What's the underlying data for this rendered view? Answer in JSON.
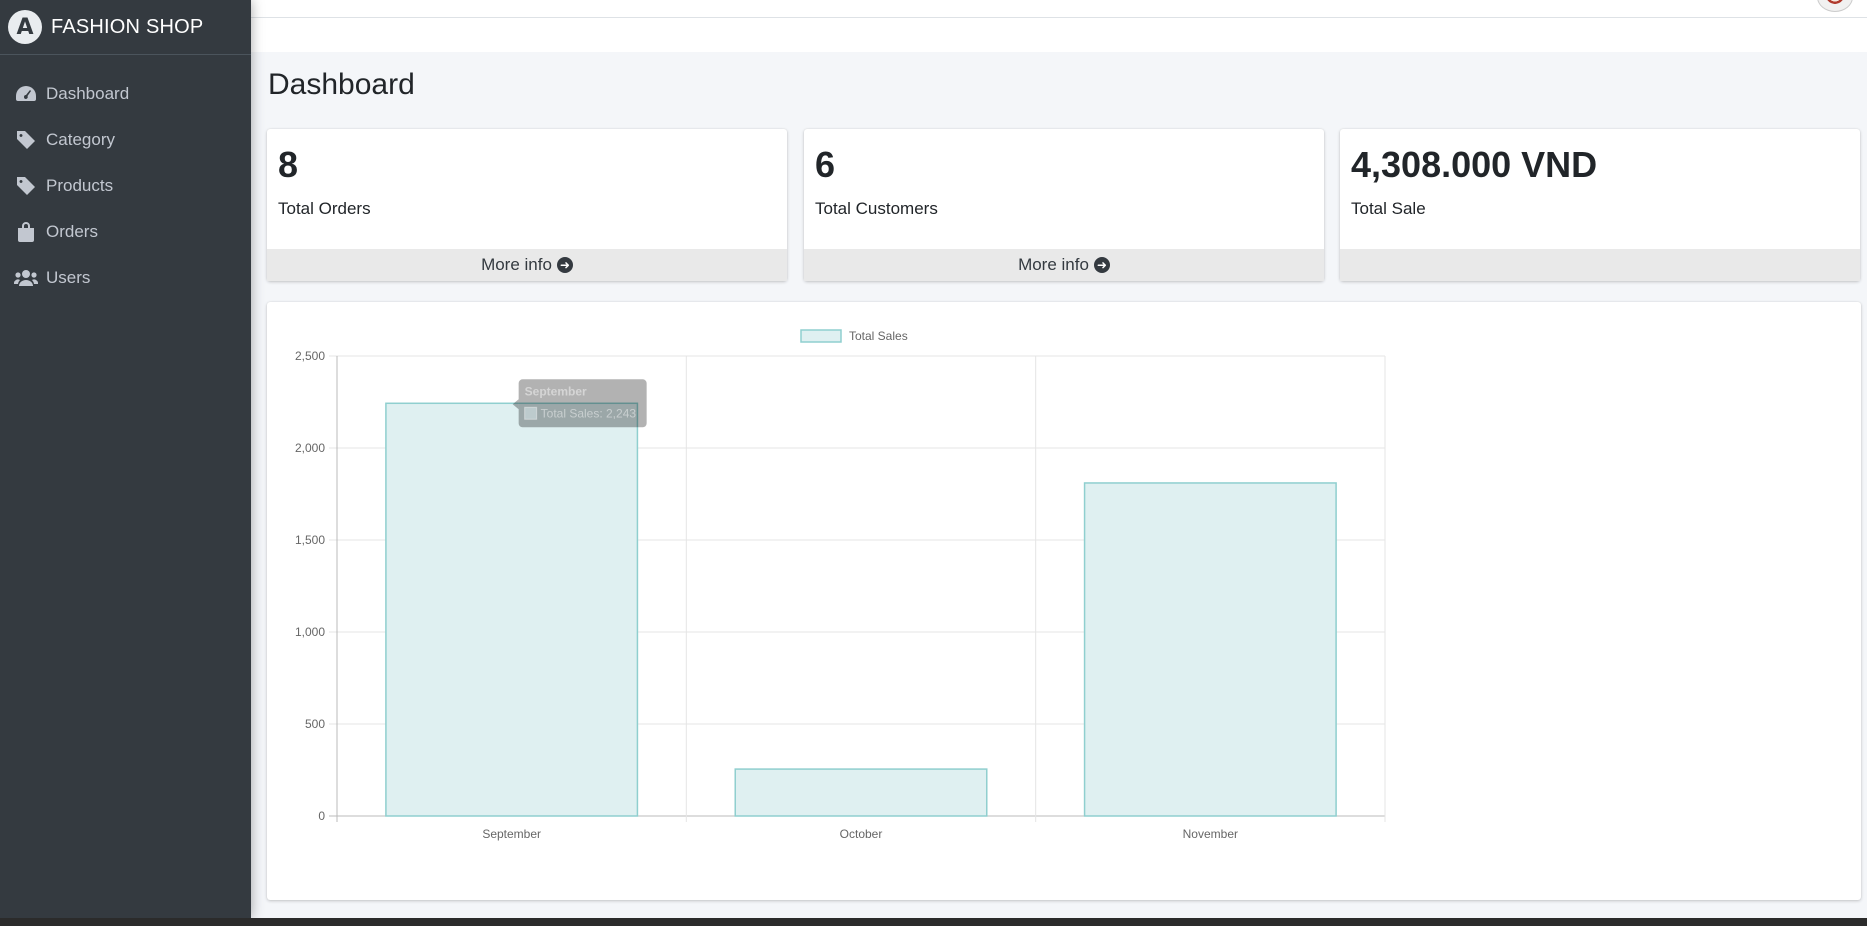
{
  "brand": {
    "name": "FASHION SHOP",
    "logo_letter": "A"
  },
  "sidebar": {
    "items": [
      {
        "label": "Dashboard",
        "icon": "tachometer-icon"
      },
      {
        "label": "Category",
        "icon": "tag-icon"
      },
      {
        "label": "Products",
        "icon": "tag-icon"
      },
      {
        "label": "Orders",
        "icon": "shopping-bag-icon"
      },
      {
        "label": "Users",
        "icon": "users-icon"
      }
    ]
  },
  "page": {
    "title": "Dashboard"
  },
  "stats": [
    {
      "value": "8",
      "label": "Total Orders",
      "footer": "More info"
    },
    {
      "value": "6",
      "label": "Total Customers",
      "footer": "More info"
    },
    {
      "value": "4,308.000 VND",
      "label": "Total Sale",
      "footer": ""
    }
  ],
  "colors": {
    "sidebar_bg": "#343a40",
    "bar_fill": "#dff0f1",
    "bar_border": "#8fcfcf",
    "tooltip_bg": "#000000"
  },
  "chart_data": {
    "type": "bar",
    "categories": [
      "September",
      "October",
      "November"
    ],
    "series": [
      {
        "name": "Total Sales",
        "values": [
          2243,
          255,
          1810
        ]
      }
    ],
    "ylim": [
      0,
      2500
    ],
    "yticks": [
      "0",
      "500",
      "1,000",
      "1,500",
      "2,000",
      "2,500"
    ],
    "grid": true,
    "legend": "top",
    "tooltip": {
      "title": "September",
      "text": "Total Sales: 2,243"
    }
  }
}
